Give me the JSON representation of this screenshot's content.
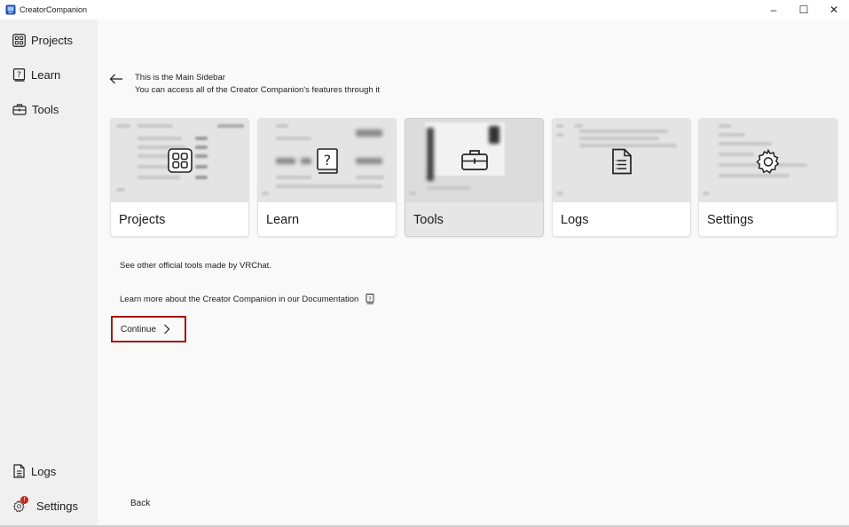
{
  "window": {
    "title": "CreatorCompanion",
    "minimize": "–",
    "maximize": "☐",
    "close": "✕"
  },
  "sidebar": {
    "items": [
      {
        "label": "Projects",
        "icon": "projects-grid-icon"
      },
      {
        "label": "Learn",
        "icon": "question-book-icon"
      },
      {
        "label": "Tools",
        "icon": "toolbox-icon"
      },
      {
        "label": "Logs",
        "icon": "document-icon"
      },
      {
        "label": "Settings",
        "icon": "gear-icon",
        "badge": "!"
      }
    ]
  },
  "main": {
    "intro_line1": "This is the Main Sidebar",
    "intro_line2": "You can access all of the Creator Companion's features through it",
    "cards": [
      {
        "label": "Projects",
        "icon": "projects-grid-icon",
        "active": false
      },
      {
        "label": "Learn",
        "icon": "question-book-icon",
        "active": false
      },
      {
        "label": "Tools",
        "icon": "toolbox-icon",
        "active": true
      },
      {
        "label": "Logs",
        "icon": "document-icon",
        "active": false
      },
      {
        "label": "Settings",
        "icon": "gear-icon",
        "active": false
      }
    ],
    "description": "See other official tools made by VRChat.",
    "doc_link": "Learn more about the Creator Companion in our Documentation",
    "continue_label": "Continue",
    "back_label": "Back"
  },
  "colors": {
    "highlight_border": "#a31515",
    "badge": "#c42b1c",
    "sidebar_bg": "#f0f0f0",
    "main_bg": "#f9f9f9"
  }
}
